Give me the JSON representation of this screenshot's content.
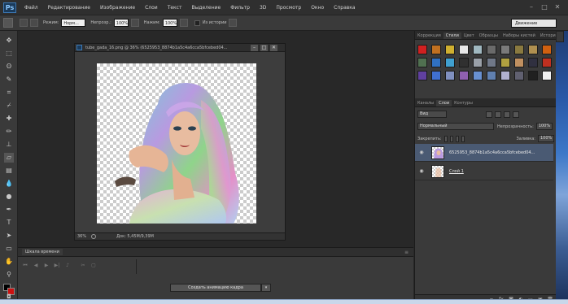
{
  "app": {
    "logo": "Ps"
  },
  "menu": [
    "Файл",
    "Редактирование",
    "Изображение",
    "Слои",
    "Текст",
    "Выделение",
    "Фильтр",
    "3D",
    "Просмотр",
    "Окно",
    "Справка"
  ],
  "options": {
    "mode_label": "Режим:",
    "mode_value": "Норм...",
    "opacity_label": "Непрозр.:",
    "opacity_value": "100%",
    "pressure_label": "Нажим:",
    "pressure_value": "100%",
    "history_label": "Из истории",
    "workspace": "Движение"
  },
  "document": {
    "title": "tube_gada_16.png @ 36% (6525953_8874b1a5c4a6cca5bfcebed04...",
    "zoom": "36%",
    "size": "Док: 5,45M/9,39M"
  },
  "timeline": {
    "tab": "Шкала времени",
    "create_button": "Создать анимацию кадра"
  },
  "styles_panel": {
    "tabs": [
      "Коррекция",
      "Стили",
      "Цвет",
      "Образцы",
      "Наборы кистей",
      "История"
    ],
    "active_tab": "Стили",
    "swatches": [
      "#d02020",
      "#c07020",
      "#d0b030",
      "#e8e8e8",
      "#a0b8c0",
      "#6a6a6a",
      "#7a7a7a",
      "#8a7a40",
      "#b09050",
      "#d06010",
      "#507050",
      "#3070c0",
      "#40a0d0",
      "#303030",
      "#9aa0a8",
      "#707888",
      "#b0a040",
      "#c09060",
      "#303040",
      "#c03020",
      "#6040a0",
      "#4070d0",
      "#8090c0",
      "#9060b0",
      "#6890d0",
      "#6080b0",
      "#b0b0d0",
      "#606070",
      "#202020",
      "#f0f0f0"
    ]
  },
  "layers_panel": {
    "tabs": [
      "Каналы",
      "Слои",
      "Контуры"
    ],
    "active_tab": "Слои",
    "kind": "Вид",
    "blend_mode": "Нормальный",
    "opacity_label": "Непрозрачность:",
    "opacity_value": "100%",
    "lock_label": "Закрепить:",
    "fill_label": "Заливка:",
    "fill_value": "100%",
    "layers": [
      {
        "name": "6525953_8874b1a5c4a6cca5bfcebed04...",
        "selected": true
      },
      {
        "name": "Слой 1",
        "selected": false
      }
    ]
  },
  "colors": {
    "accent": "#4a5a73",
    "fg_swatch": "#000000",
    "bg_swatch": "#cc1111"
  }
}
